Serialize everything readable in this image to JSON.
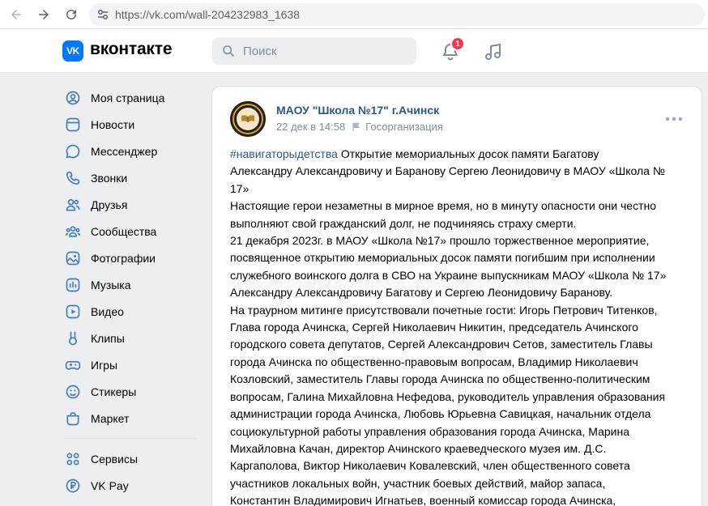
{
  "browser": {
    "url": "https://vk.com/wall-204232983_1638"
  },
  "header": {
    "logo_text": "VK",
    "wordmark": "вконтакте",
    "search_placeholder": "Поиск",
    "notification_count": "1"
  },
  "sidebar": {
    "items": [
      {
        "label": "Моя страница",
        "icon": "user-icon"
      },
      {
        "label": "Новости",
        "icon": "news-icon"
      },
      {
        "label": "Мессенджер",
        "icon": "messenger-icon"
      },
      {
        "label": "Звонки",
        "icon": "phone-icon"
      },
      {
        "label": "Друзья",
        "icon": "friends-icon"
      },
      {
        "label": "Сообщества",
        "icon": "communities-icon"
      },
      {
        "label": "Фотографии",
        "icon": "photos-icon"
      },
      {
        "label": "Музыка",
        "icon": "music-icon"
      },
      {
        "label": "Видео",
        "icon": "video-icon"
      },
      {
        "label": "Клипы",
        "icon": "clips-icon"
      },
      {
        "label": "Игры",
        "icon": "games-icon"
      },
      {
        "label": "Стикеры",
        "icon": "stickers-icon"
      },
      {
        "label": "Маркет",
        "icon": "market-icon"
      }
    ],
    "extra_items": [
      {
        "label": "Сервисы",
        "icon": "services-icon"
      },
      {
        "label": "VK Pay",
        "icon": "vkpay-icon"
      }
    ]
  },
  "post": {
    "author": "МАОУ \"Школа №17\" г.Ачинск",
    "date": "22 дек в 14:58",
    "author_type": "Госорганизация",
    "hashtag": "#навигаторыдетства",
    "lines": [
      " Открытие мемориальных досок памяти Багатову",
      "Александру Александровичу и Баранову Сергею Леонидовичу в МАОУ «Школа №",
      "17»",
      "Настоящие герои незаметны в мирное время, но в минуту опасности они честно",
      "выполняют свой гражданский долг, не подчиняясь страху смерти.",
      "21 декабря 2023г. в МАОУ «Школа №17» прошло торжественное мероприятие,",
      "посвященное открытию мемориальных досок памяти погибшим при исполнении",
      "служебного воинского долга в СВО на Украине выпускникам МАОУ «Школа № 17»",
      "Александру Александровичу Багатову и Сергею Леонидовичу Баранову.",
      "На траурном митинге присутствовали почетные гости: Игорь Петрович Титенков,",
      "Глава города Ачинска, Сергей Николаевич Никитин, председатель Ачинского",
      "городского совета депутатов, Сергей Александрович Сетов, заместитель Главы",
      "города Ачинска по общественно-правовым вопросам, Владимир Николаевич",
      "Козловский, заместитель Главы города Ачинска по общественно-политическим",
      "вопросам, Галина Михайловна Нефедова, руководитель управления образования",
      "администрации города Ачинска, Любовь Юрьевна Савицкая, начальник отдела",
      "социокультурной работы управления образования города Ачинска, Марина",
      "Михайловна Качан, директор Ачинского краеведческого музея им. Д.С.",
      "Каргаполова, Виктор Николаевич Ковалевский, член общественного совета",
      "участников локальных войн, участник боевых действий, майор запаса,",
      "Константин Владимирович Игнатьев, военный комиссар города Ачинска,"
    ]
  },
  "colors": {
    "vk_blue": "#0077ff",
    "link": "#2a5885",
    "badge": "#ff3347",
    "muted": "#818c99"
  }
}
